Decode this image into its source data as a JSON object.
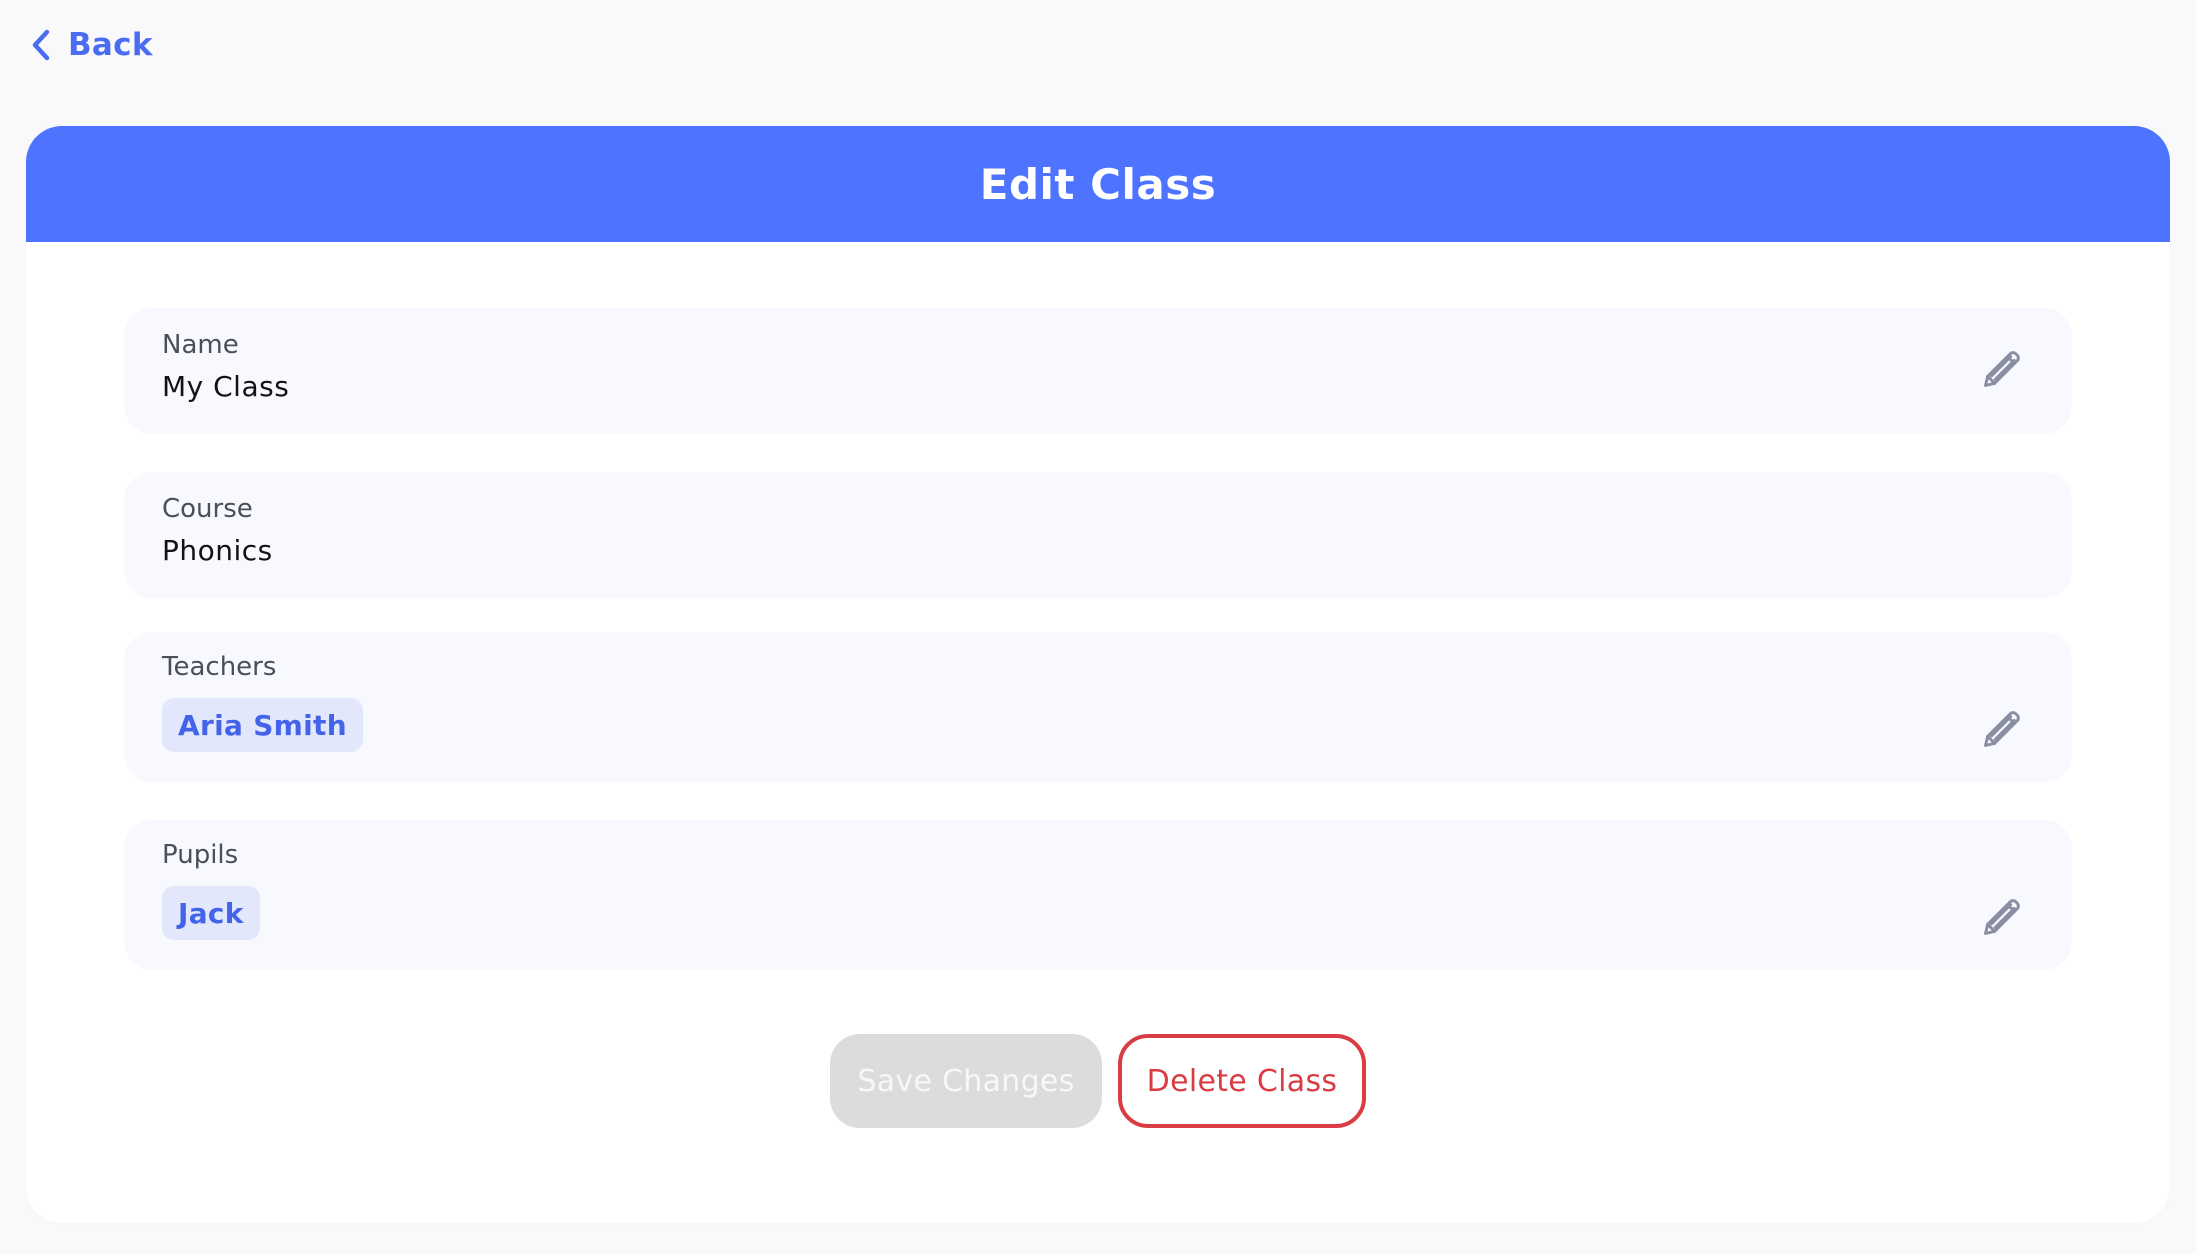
{
  "nav": {
    "back_label": "Back"
  },
  "header": {
    "title": "Edit Class"
  },
  "fields": {
    "name": {
      "label": "Name",
      "value": "My Class"
    },
    "course": {
      "label": "Course",
      "value": "Phonics"
    },
    "teachers": {
      "label": "Teachers",
      "items": [
        "Aria Smith"
      ]
    },
    "pupils": {
      "label": "Pupils",
      "items": [
        "Jack"
      ]
    }
  },
  "actions": {
    "save_label": "Save Changes",
    "delete_label": "Delete Class"
  },
  "icons": {
    "back": "chevron-left-icon",
    "edit": "pencil-icon"
  },
  "colors": {
    "accent": "#4d73ff",
    "link": "#4a6cf1",
    "danger": "#d93c42",
    "chip_bg": "#e2e7fb",
    "disabled_bg": "#dcdcdf"
  }
}
